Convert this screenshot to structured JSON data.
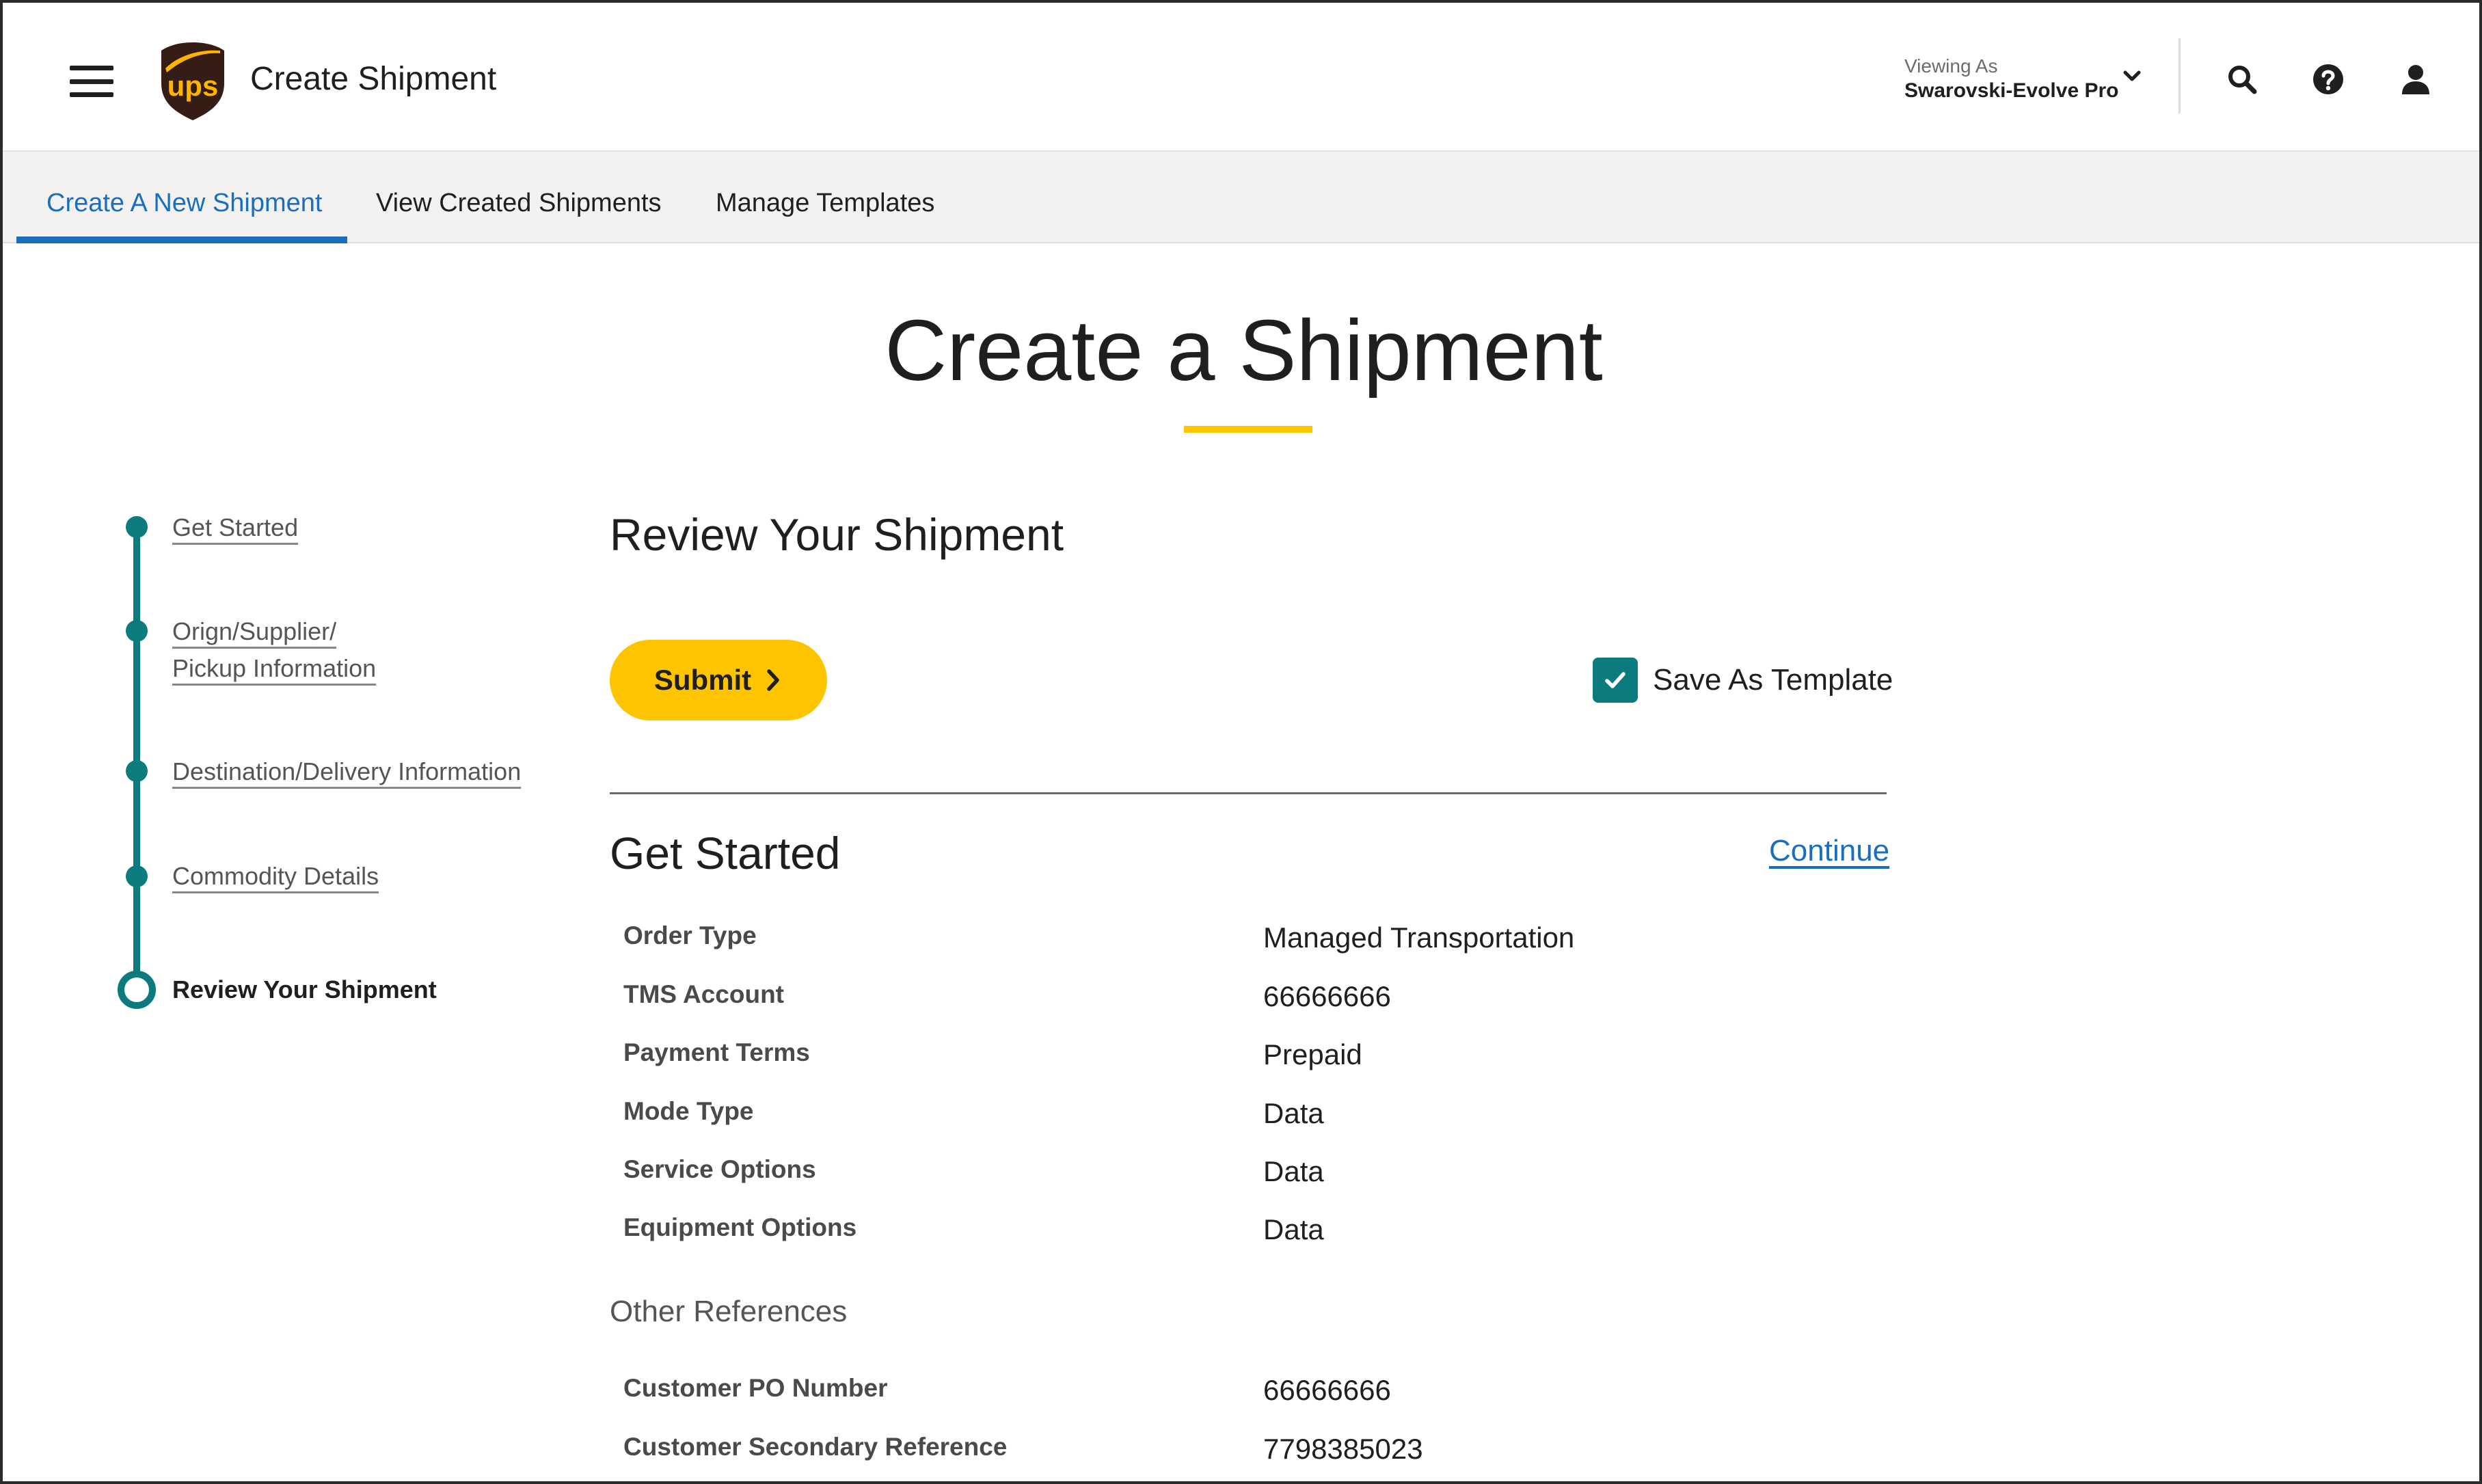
{
  "header": {
    "title": "Create Shipment",
    "viewing_label": "Viewing As",
    "viewing_value": "Swarovski-Evolve Pro",
    "brand": "ups",
    "icons": [
      "menu-icon",
      "search-icon",
      "help-icon",
      "user-icon"
    ]
  },
  "tabs": [
    {
      "label": "Create A New Shipment",
      "active": true
    },
    {
      "label": "View Created Shipments",
      "active": false
    },
    {
      "label": "Manage Templates",
      "active": false
    }
  ],
  "page_title": "Create a Shipment",
  "stepper": {
    "steps": [
      {
        "label_line1": "Get Started",
        "label_line2": ""
      },
      {
        "label_line1": "Orign/Supplier/",
        "label_line2": "Pickup Information"
      },
      {
        "label_line1": "Destination/Delivery Information",
        "label_line2": ""
      },
      {
        "label_line1": "Commodity Details",
        "label_line2": ""
      },
      {
        "label_line1": "Review Your Shipment",
        "label_line2": "",
        "current": true
      }
    ]
  },
  "review": {
    "heading": "Review Your Shipment",
    "submit_label": "Submit",
    "save_template_label": "Save As Template",
    "save_template_checked": true
  },
  "get_started": {
    "heading": "Get Started",
    "continue_label": "Continue",
    "rows": [
      {
        "label": "Order Type",
        "value": "Managed Transportation"
      },
      {
        "label": "TMS Account",
        "value": "66666666"
      },
      {
        "label": "Payment Terms",
        "value": "Prepaid"
      },
      {
        "label": "Mode Type",
        "value": "Data"
      },
      {
        "label": "Service Options",
        "value": "Data"
      },
      {
        "label": "Equipment Options",
        "value": "Data"
      }
    ]
  },
  "other_references": {
    "heading": "Other References",
    "rows": [
      {
        "label": "Customer PO Number",
        "value": "66666666"
      },
      {
        "label": "Customer Secondary Reference",
        "value": "7798385023"
      }
    ]
  },
  "colors": {
    "accent_blue": "#1a6ec0",
    "teal": "#0c7b7e",
    "ups_yellow": "#ffc400",
    "ups_brown": "#351c15"
  }
}
